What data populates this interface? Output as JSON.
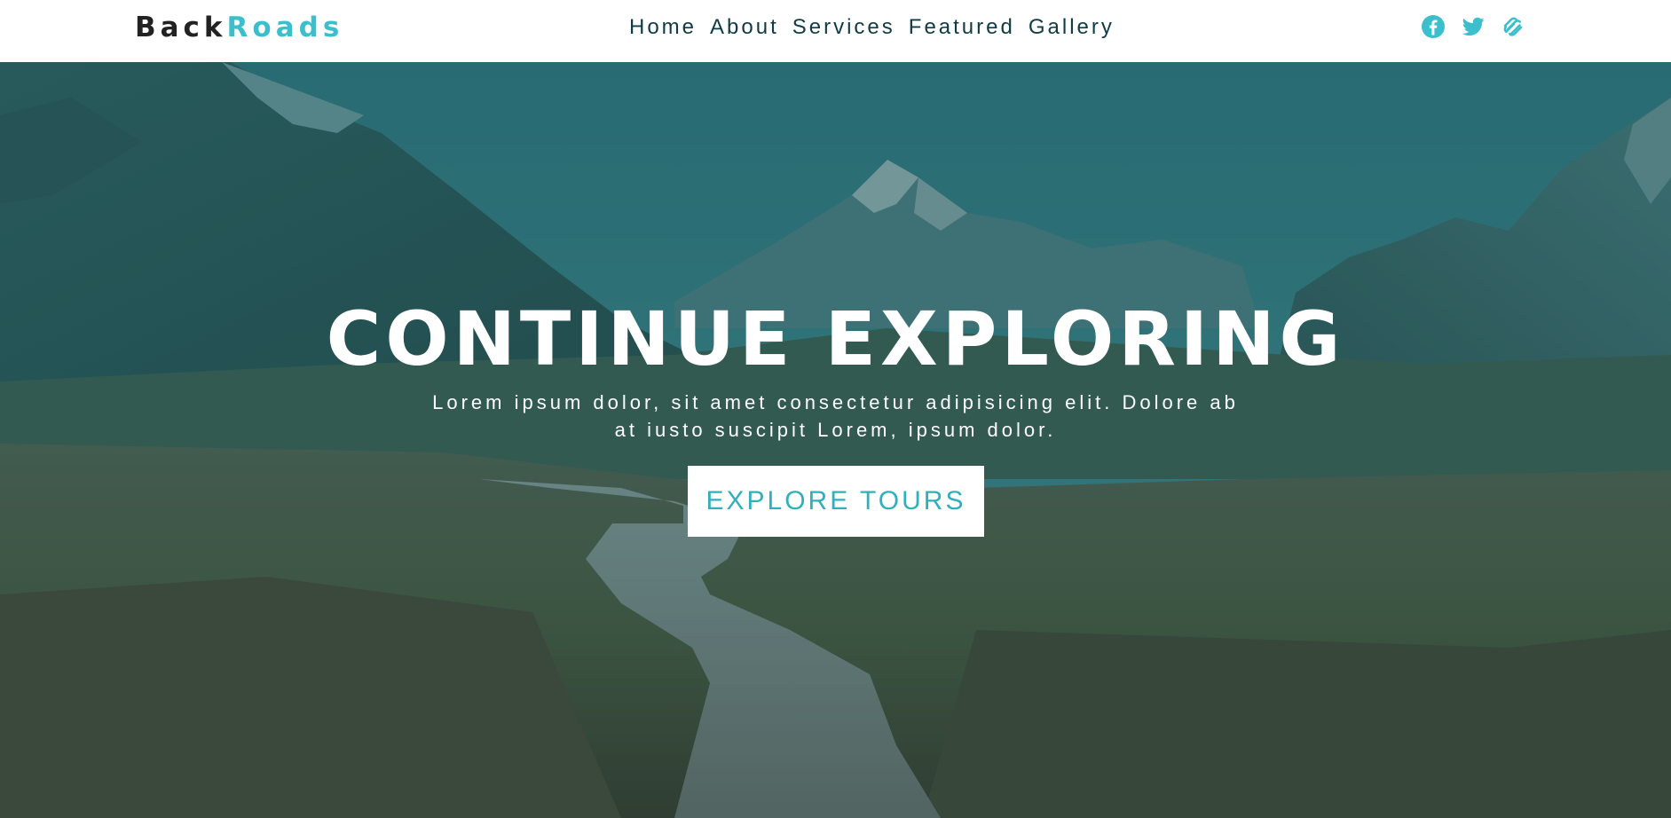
{
  "brand": {
    "part1": "Back",
    "part2": "Roads"
  },
  "nav": {
    "links": [
      {
        "label": "Home"
      },
      {
        "label": "About"
      },
      {
        "label": "Services"
      },
      {
        "label": "Featured"
      },
      {
        "label": "Gallery"
      }
    ],
    "social_icons": [
      "facebook-icon",
      "twitter-icon",
      "squarespace-icon"
    ]
  },
  "hero": {
    "title": "CONTINUE EXPLORING",
    "text": "Lorem ipsum dolor, sit amet consectetur adipisicing elit. Dolore ab at iusto suscipit Lorem, ipsum dolor.",
    "button_label": "EXPLORE TOURS"
  },
  "colors": {
    "accent": "#3cbfcc",
    "nav_text": "#0f3b47",
    "logo_dark": "#222222",
    "overlay": "#2d8a8f",
    "button_text": "#2fb0bc"
  }
}
